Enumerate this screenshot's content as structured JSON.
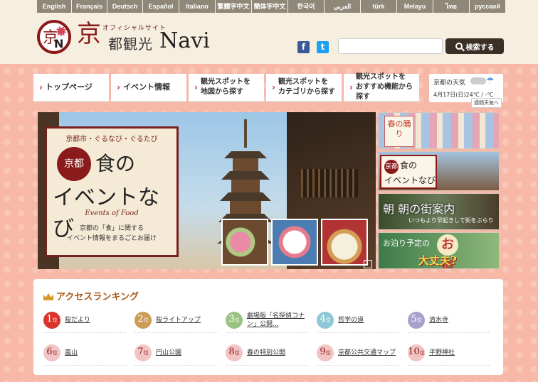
{
  "languages": [
    "English",
    "Français",
    "Deutsch",
    "Español",
    "Italiano",
    "繁體字中文",
    "簡体字中文",
    "한국어",
    "العربي",
    "türk",
    "Melayu",
    "ไทย",
    "русский"
  ],
  "header": {
    "logo_mark_kanji": "京",
    "logo_mark_letter": "N",
    "logo_big": "京",
    "logo_official": "オフィシャルサイト",
    "logo_kyoto": "都観光",
    "logo_navi": "Navi",
    "search_placeholder": "",
    "search_button": "検索する"
  },
  "nav": [
    {
      "label": "トップページ"
    },
    {
      "label": "イベント情報"
    },
    {
      "label1": "観光スポットを",
      "label2": "地図から探す"
    },
    {
      "label1": "観光スポットを",
      "label2": "カテゴリから探す"
    },
    {
      "label1": "観光スポットを",
      "label2": "おすすめ機能から探す"
    }
  ],
  "weather": {
    "title": "京都の天気",
    "date": "4月17日(日)24℃ / -℃",
    "link": "週間天気へ"
  },
  "hero": {
    "subtitle": "京都市・ぐるなび・ぐるたび",
    "seal": "京都",
    "big1": "食の",
    "big2": "イベントなび",
    "english": "Events of Food",
    "desc1": "京都の「食」に関する",
    "desc2": "イベント情報をまるごとお届け"
  },
  "banners": {
    "b1": "春の踊り",
    "b2_seal": "京都",
    "b2_line1": "食の",
    "b2_line2": "イベントなび",
    "b3_big": "朝 朝の街案内",
    "b3_small": "いつもより早起きして街をぶらり",
    "b4_small": "お泊り予定の",
    "b4_yado": "お宿",
    "b4_big": "大丈夫?"
  },
  "ranking": {
    "title": "アクセスランキング",
    "rank_suffix": "位",
    "items": [
      {
        "rank": "1",
        "label": "桜だより",
        "color": "#d9342b"
      },
      {
        "rank": "2",
        "label": "桜ライトアップ",
        "color": "#cc9c5a"
      },
      {
        "rank": "3",
        "label": "劇場版「名探偵コナン」公開...",
        "color": "#9ac383"
      },
      {
        "rank": "4",
        "label": "哲学の道",
        "color": "#8ec7d6"
      },
      {
        "rank": "5",
        "label": "清水寺",
        "color": "#a8a0cc"
      },
      {
        "rank": "6",
        "label": "嵐山",
        "color": "#f2c4c4"
      },
      {
        "rank": "7",
        "label": "円山公園",
        "color": "#f2c4c4"
      },
      {
        "rank": "8",
        "label": "春の特別公開",
        "color": "#f2c4c4"
      },
      {
        "rank": "9",
        "label": "京都公共交通マップ",
        "color": "#f2c4c4"
      },
      {
        "rank": "10",
        "label": "平野神社",
        "color": "#f2c4c4"
      }
    ]
  }
}
